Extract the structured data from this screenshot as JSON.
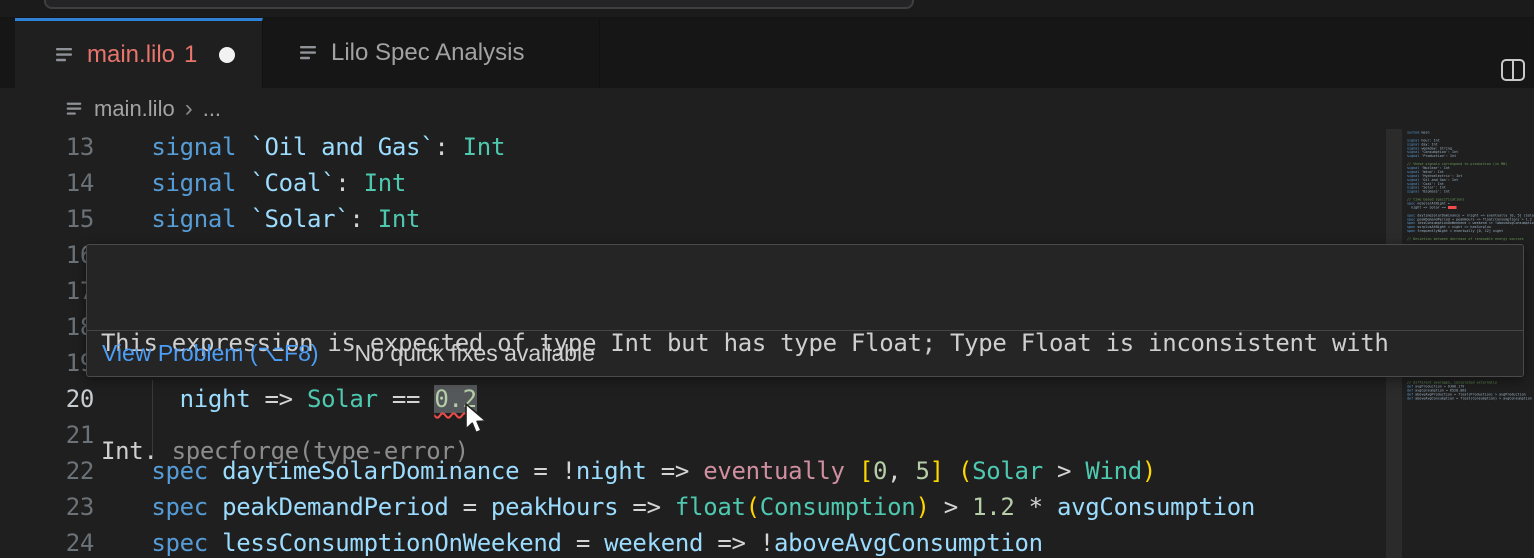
{
  "colors": {
    "editor_bg": "#1f1f1f",
    "tabbar_bg": "#161617",
    "titlebar_bg": "#1b1b1c",
    "active_tab_border": "#2e81d6",
    "error_tab_label": "#e8746c",
    "keyword": "#569cd6",
    "variable": "#9cdcfe",
    "type": "#4ec9b0",
    "number": "#b5cea8",
    "bracket": "#ffd700",
    "control_keyword": "#cf8fa0",
    "comment": "#6a9955",
    "error_red": "#f14c4c",
    "link_blue": "#4b9df5"
  },
  "tabs": [
    {
      "label": "main.lilo",
      "badge": "1",
      "modified_dot": "●",
      "active": true
    },
    {
      "label": "Lilo Spec Analysis",
      "active": false
    }
  ],
  "breadcrumb": {
    "file": "main.lilo",
    "separator": "›",
    "rest": "..."
  },
  "tooltip": {
    "message_line1": "This expression is expected of type Int but has type Float; Type Float is inconsistent with",
    "message_line2": "Int.",
    "source": "specforge(type-error)",
    "view_problem": "View Problem (⌥F8)",
    "no_quick_fixes": "No quick fixes available"
  },
  "editor": {
    "lines": [
      {
        "num": "13",
        "tokens": [
          [
            "  ",
            "pl"
          ],
          [
            "signal",
            "kw"
          ],
          [
            " ",
            "pl"
          ],
          [
            "`Oil and Gas`",
            "var"
          ],
          [
            ":",
            "op"
          ],
          [
            " ",
            "pl"
          ],
          [
            "Int",
            "typ"
          ]
        ]
      },
      {
        "num": "14",
        "tokens": [
          [
            "  ",
            "pl"
          ],
          [
            "signal",
            "kw"
          ],
          [
            " ",
            "pl"
          ],
          [
            "`Coal`",
            "var"
          ],
          [
            ":",
            "op"
          ],
          [
            " ",
            "pl"
          ],
          [
            "Int",
            "typ"
          ]
        ]
      },
      {
        "num": "15",
        "tokens": [
          [
            "  ",
            "pl"
          ],
          [
            "signal",
            "kw"
          ],
          [
            " ",
            "pl"
          ],
          [
            "`Solar`",
            "var"
          ],
          [
            ":",
            "op"
          ],
          [
            " ",
            "pl"
          ],
          [
            "Int",
            "typ"
          ]
        ]
      },
      {
        "num": "16",
        "tokens": []
      },
      {
        "num": "17",
        "tokens": []
      },
      {
        "num": "18",
        "tokens": []
      },
      {
        "num": "19",
        "tokens": []
      },
      {
        "num": "20",
        "active": true,
        "tokens": [
          [
            "    ",
            "pl"
          ],
          [
            "night",
            "var"
          ],
          [
            " ",
            "pl"
          ],
          [
            "=>",
            "op"
          ],
          [
            " ",
            "pl"
          ],
          [
            "Solar",
            "typ"
          ],
          [
            " ",
            "pl"
          ],
          [
            "==",
            "op"
          ],
          [
            " ",
            "pl"
          ],
          [
            "0.2",
            "num err"
          ]
        ]
      },
      {
        "num": "21",
        "tokens": []
      },
      {
        "num": "22",
        "tokens": [
          [
            "  ",
            "pl"
          ],
          [
            "spec",
            "kw"
          ],
          [
            " ",
            "pl"
          ],
          [
            "daytimeSolarDominance",
            "var"
          ],
          [
            " = ",
            "op"
          ],
          [
            "!",
            "op"
          ],
          [
            "night",
            "var"
          ],
          [
            " ",
            "pl"
          ],
          [
            "=>",
            "op"
          ],
          [
            " ",
            "pl"
          ],
          [
            "eventually",
            "ctl"
          ],
          [
            " ",
            "pl"
          ],
          [
            "[",
            "br"
          ],
          [
            "0",
            "num"
          ],
          [
            ", ",
            "op"
          ],
          [
            "5",
            "num"
          ],
          [
            "]",
            "br"
          ],
          [
            " ",
            "pl"
          ],
          [
            "(",
            "br"
          ],
          [
            "Solar",
            "typ"
          ],
          [
            " > ",
            "op"
          ],
          [
            "Wind",
            "typ"
          ],
          [
            ")",
            "br"
          ]
        ]
      },
      {
        "num": "23",
        "tokens": [
          [
            "  ",
            "pl"
          ],
          [
            "spec",
            "kw"
          ],
          [
            " ",
            "pl"
          ],
          [
            "peakDemandPeriod",
            "var"
          ],
          [
            " = ",
            "op"
          ],
          [
            "peakHours",
            "var"
          ],
          [
            " ",
            "pl"
          ],
          [
            "=>",
            "op"
          ],
          [
            " ",
            "pl"
          ],
          [
            "float",
            "typ"
          ],
          [
            "(",
            "br"
          ],
          [
            "Consumption",
            "typ"
          ],
          [
            ")",
            "br"
          ],
          [
            " > ",
            "op"
          ],
          [
            "1.2",
            "num"
          ],
          [
            " ",
            "pl"
          ],
          [
            "*",
            "op"
          ],
          [
            " ",
            "pl"
          ],
          [
            "avgConsumption",
            "var"
          ]
        ]
      },
      {
        "num": "24",
        "tokens": [
          [
            "  ",
            "pl"
          ],
          [
            "spec",
            "kw"
          ],
          [
            " ",
            "pl"
          ],
          [
            "lessConsumptionOnWeekend",
            "var"
          ],
          [
            " = ",
            "op"
          ],
          [
            "weekend",
            "var"
          ],
          [
            " ",
            "pl"
          ],
          [
            "=>",
            "op"
          ],
          [
            " ",
            "pl"
          ],
          [
            "!",
            "op"
          ],
          [
            "aboveAvgConsumption",
            "var"
          ]
        ]
      }
    ],
    "minimap": {
      "top": [
        {
          "kw": "system",
          "rest": " main"
        },
        {},
        {
          "kw": "signal",
          "rest": " hour: Int"
        },
        {
          "kw": "signal",
          "rest": " day: Int"
        },
        {
          "kw": "signal",
          "rest": " weekday: String"
        },
        {
          "kw": "signal",
          "rest": " 'Consumption': Int"
        },
        {
          "kw": "signal",
          "rest": " 'Production': Int"
        },
        {},
        {
          "cm": "// these signals correspond to production (in MW)"
        },
        {
          "kw": "signal",
          "rest": " 'Nuclear': Int"
        },
        {
          "kw": "signal",
          "rest": " 'Wind': Int"
        },
        {
          "kw": "signal",
          "rest": " 'Hydroelectric': Int"
        },
        {
          "kw": "signal",
          "rest": " 'Oil and Gas': Int"
        },
        {
          "kw": "signal",
          "rest": " 'Coal': Int"
        },
        {
          "kw": "signal",
          "rest": " 'Solar': Int"
        },
        {
          "kw": "signal",
          "rest": " 'Biomass': Int"
        },
        {},
        {
          "cm": "// time based specifications"
        },
        {
          "kw": "spec",
          "rest": " noSolarAtNight ="
        },
        {
          "kw": "",
          "rest": "  night => Solar == ",
          "err": true
        },
        {},
        {
          "kw": "spec",
          "rest": " daytimeSolarDominance = !night => eventually [0, 5] (Solar"
        },
        {
          "kw": "spec",
          "rest": " peakDemandPeriod = peakHours => float(Consumption) > 1.2 *"
        },
        {
          "kw": "spec",
          "rest": " lessConsumptionOnWeekend = weekend => !aboveAvgConsumption"
        },
        {
          "kw": "spec",
          "rest": " surplusAtNight = night => hasSurplus"
        },
        {
          "kw": "spec",
          "rest": " frequentlyNight = eventually [0, 12] night"
        },
        {},
        {
          "cm": "// Deviation between decrease of renewable energy sources"
        }
      ],
      "bottom": [
        {
          "cm": "// different averages, calculated externally"
        },
        {
          "kw": "def",
          "rest": " avgProduction = 6308.179"
        },
        {
          "kw": "def",
          "rest": " avgConsumption = 6528.063"
        },
        {
          "kw": "def",
          "rest": " aboveAvgProduction = float(Production) > avgProduction"
        },
        {
          "kw": "def",
          "rest": " aboveAvgConsumption = float(Consumption) > avgConsumption"
        }
      ]
    }
  }
}
